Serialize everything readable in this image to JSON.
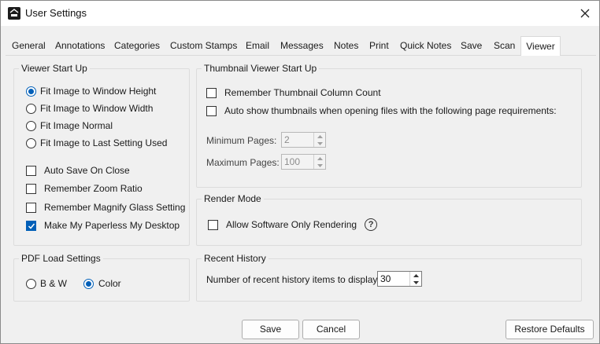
{
  "window": {
    "title": "User Settings",
    "app_icon": "paperless-app-icon",
    "close_icon": "close-icon"
  },
  "tabs": [
    {
      "label": "General"
    },
    {
      "label": "Annotations"
    },
    {
      "label": "Categories"
    },
    {
      "label": "Custom Stamps"
    },
    {
      "label": "Email"
    },
    {
      "label": "Messages"
    },
    {
      "label": "Notes"
    },
    {
      "label": "Print"
    },
    {
      "label": "Quick Notes"
    },
    {
      "label": "Save"
    },
    {
      "label": "Scan"
    },
    {
      "label": "Viewer",
      "active": true
    }
  ],
  "viewer_startup": {
    "label": "Viewer Start Up",
    "radios": [
      {
        "label": "Fit Image to Window Height",
        "checked": true
      },
      {
        "label": "Fit Image to Window Width",
        "checked": false
      },
      {
        "label": "Fit Image Normal",
        "checked": false
      },
      {
        "label": "Fit Image to Last Setting Used",
        "checked": false
      }
    ],
    "checkboxes": [
      {
        "label": "Auto Save On Close",
        "checked": false
      },
      {
        "label": "Remember Zoom Ratio",
        "checked": false
      },
      {
        "label": "Remember Magnify Glass Setting",
        "checked": false
      },
      {
        "label": "Make My Paperless My Desktop",
        "checked": true
      }
    ]
  },
  "pdf_load": {
    "label": "PDF Load Settings",
    "radios": [
      {
        "label": "B & W",
        "checked": false
      },
      {
        "label": "Color",
        "checked": true
      }
    ]
  },
  "thumbnail_startup": {
    "label": "Thumbnail Viewer Start Up",
    "checkboxes": [
      {
        "label": "Remember Thumbnail Column Count",
        "checked": false
      },
      {
        "label": "Auto show thumbnails when opening files with the following page requirements:",
        "checked": false
      }
    ],
    "min_pages": {
      "label": "Minimum Pages:",
      "value": "2"
    },
    "max_pages": {
      "label": "Maximum Pages:",
      "value": "100"
    }
  },
  "render_mode": {
    "label": "Render Mode",
    "checkbox": {
      "label": "Allow Software Only Rendering",
      "checked": false
    },
    "help_icon": "help-icon",
    "help_glyph": "?"
  },
  "recent_history": {
    "label": "Recent History",
    "items_label": "Number of recent history items to display:",
    "items_value": "30"
  },
  "buttons": {
    "save": "Save",
    "cancel": "Cancel",
    "restore": "Restore Defaults"
  },
  "colors": {
    "accent": "#005fb8",
    "background": "#f0f0f0",
    "titlebar": "#ffffff"
  }
}
